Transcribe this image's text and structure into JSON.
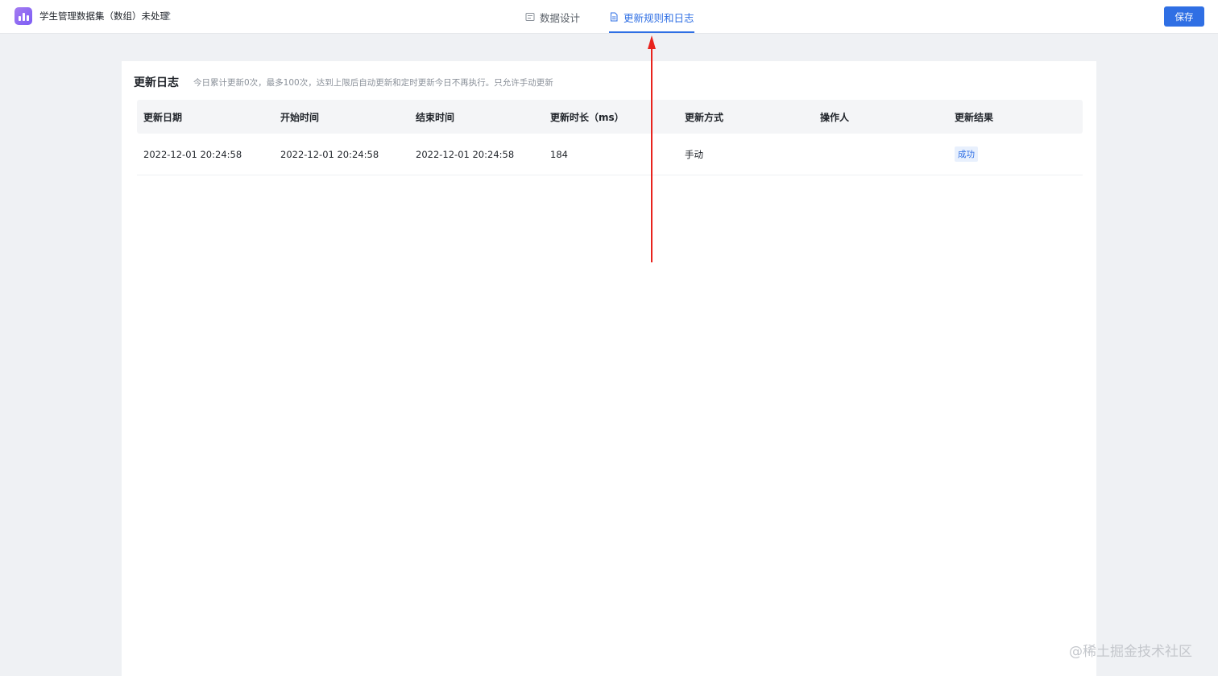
{
  "header": {
    "dataset_title": "学生管理数据集（数组）未处理",
    "tabs": [
      {
        "label": "数据设计",
        "icon": "table-icon",
        "active": false
      },
      {
        "label": "更新规则和日志",
        "icon": "document-icon",
        "active": true
      }
    ],
    "save_label": "保存"
  },
  "log_section": {
    "title": "更新日志",
    "note": "今日累计更新0次，最多100次，达到上限后自动更新和定时更新今日不再执行。只允许手动更新",
    "columns": [
      "更新日期",
      "开始时间",
      "结束时间",
      "更新时长（ms）",
      "更新方式",
      "操作人",
      "更新结果"
    ],
    "rows": [
      {
        "date": "2022-12-01 20:24:58",
        "start": "2022-12-01 20:24:58",
        "end": "2022-12-01 20:24:58",
        "duration": "184",
        "mode": "手动",
        "operator": "",
        "result": "成功"
      }
    ]
  },
  "watermark": "@稀土掘金技术社区",
  "colors": {
    "accent": "#2f6fe4",
    "annotation_arrow": "#e8231d",
    "page_background": "#eff1f4",
    "logo_gradient": "#8f6df2"
  }
}
